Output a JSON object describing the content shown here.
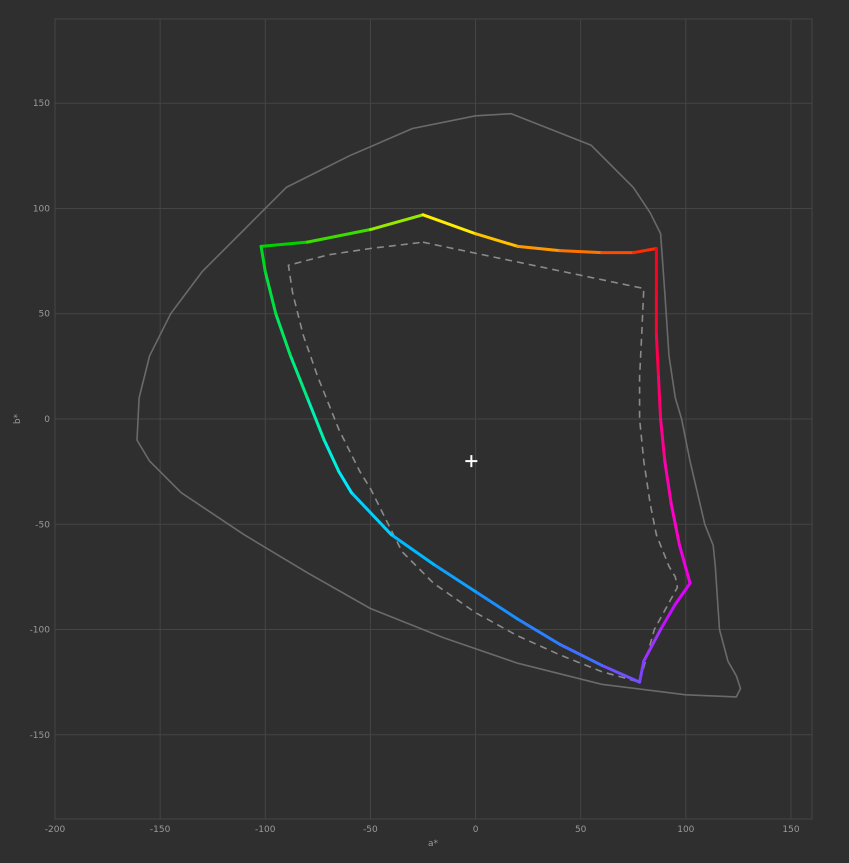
{
  "chart_data": {
    "type": "line",
    "xlabel": "a*",
    "ylabel": "b*",
    "xlim": [
      -200,
      160
    ],
    "ylim": [
      -190,
      190
    ],
    "x_ticks": [
      -200,
      -150,
      -100,
      -50,
      0,
      50,
      100,
      150
    ],
    "y_ticks": [
      150,
      100,
      50,
      0,
      -50,
      -100,
      -150
    ],
    "grid": true,
    "colors": {
      "background": "#2f2f2f",
      "grid": "#454545",
      "outline": "#6a6a6a",
      "dashed": "#8a8a8a",
      "white_point": "#ffffff"
    },
    "series": [
      {
        "style": "outline",
        "x": [
          17,
          55,
          75,
          83,
          88,
          90,
          92,
          95,
          98,
          102,
          109,
          113,
          114,
          116,
          120,
          124,
          126,
          124,
          100,
          60,
          20,
          -15,
          -50,
          -80,
          -110,
          -140,
          -155,
          -161,
          -160,
          -155,
          -145,
          -130,
          -110,
          -90,
          -60,
          -30,
          0
        ],
        "y": [
          145,
          130,
          110,
          98,
          88,
          60,
          30,
          10,
          0,
          -20,
          -50,
          -60,
          -70,
          -100,
          -115,
          -122,
          -128,
          -132,
          -131,
          -126,
          -116,
          -104,
          -90,
          -73,
          -55,
          -35,
          -20,
          -10,
          10,
          30,
          50,
          70,
          90,
          110,
          125,
          138,
          144
        ]
      },
      {
        "style": "dashed",
        "x": [
          -25,
          80,
          79,
          78,
          78,
          80,
          83,
          86,
          90,
          92,
          95,
          96,
          85,
          78,
          60,
          40,
          20,
          0,
          -20,
          -35,
          -50,
          -55,
          -65,
          -75,
          -82,
          -87,
          -89,
          -70,
          -50,
          -25
        ],
        "y": [
          84,
          62,
          40,
          20,
          0,
          -20,
          -40,
          -55,
          -65,
          -70,
          -75,
          -80,
          -100,
          -125,
          -120,
          -112,
          -103,
          -92,
          -78,
          -63,
          -33,
          -25,
          -5,
          20,
          40,
          60,
          73,
          78,
          81,
          84
        ]
      },
      {
        "style": "gamut",
        "x": [
          -102,
          -80,
          -50,
          -25,
          0,
          20,
          40,
          60,
          75,
          86,
          86,
          86,
          87,
          88,
          90,
          93,
          97,
          102,
          95,
          88,
          80,
          78,
          60,
          40,
          20,
          0,
          -20,
          -40,
          -59,
          -65,
          -72,
          -80,
          -88,
          -95,
          -100,
          -102
        ],
        "y": [
          82,
          84,
          90,
          97,
          88,
          82,
          80,
          79,
          79,
          81,
          60,
          40,
          20,
          0,
          -20,
          -40,
          -60,
          -78,
          -88,
          -100,
          -115,
          -125,
          -117,
          -107,
          -95,
          -82,
          -69,
          -55,
          -35,
          -25,
          -10,
          10,
          30,
          50,
          70,
          82
        ],
        "colors": [
          "#00d200",
          "#3cdc00",
          "#96ea00",
          "#ffee00",
          "#ffc200",
          "#ff9800",
          "#ff7400",
          "#ff4a00",
          "#ff2c00",
          "#ff0020",
          "#ff0030",
          "#ff0050",
          "#ff0070",
          "#ff0090",
          "#ff00b0",
          "#ff00c8",
          "#f000e0",
          "#e000ff",
          "#c010ff",
          "#a030ff",
          "#8040ff",
          "#7050ff",
          "#4070ff",
          "#2a80ff",
          "#1890ff",
          "#10a0ff",
          "#00b8ff",
          "#00d0ff",
          "#00e8ff",
          "#00f0e0",
          "#00f0b0",
          "#00ec80",
          "#00e860",
          "#00e040",
          "#00d820",
          "#00d200"
        ]
      },
      {
        "style": "white-point",
        "x": [
          -2
        ],
        "y": [
          -20
        ]
      }
    ]
  }
}
